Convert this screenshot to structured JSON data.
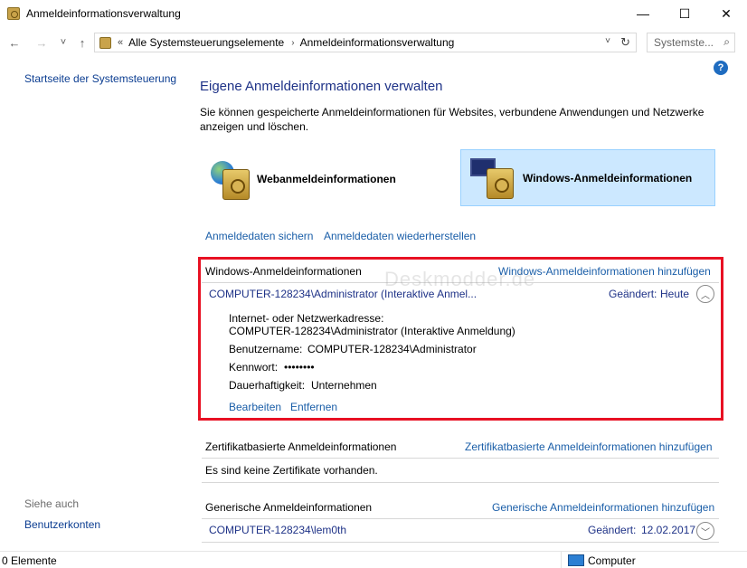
{
  "window": {
    "title": "Anmeldeinformationsverwaltung",
    "controls": {
      "minimize": "—",
      "maximize": "☐",
      "close": "✕"
    }
  },
  "navbar": {
    "back": "←",
    "forward": "→",
    "recent": "˅",
    "up": "↑",
    "breadcrumb_prefix": "«",
    "crumbs": [
      "Alle Systemsteuerungselemente",
      "Anmeldeinformationsverwaltung"
    ],
    "crumb_arrow": "›",
    "dropdown": "˅",
    "refresh": "↻",
    "search_placeholder": "Systemste...",
    "search_icon": "⌕"
  },
  "left_pane": {
    "home_link": "Startseite der Systemsteuerung",
    "see_also_label": "Siehe auch",
    "see_also_link": "Benutzerkonten"
  },
  "help_icon": "?",
  "main": {
    "heading": "Eigene Anmeldeinformationen verwalten",
    "description": "Sie können gespeicherte Anmeldeinformationen für Websites, verbundene Anwendungen und Netzwerke anzeigen und löschen.",
    "categories": [
      {
        "label": "Webanmeldeinformationen",
        "icon": "web-credentials-icon",
        "selected": false
      },
      {
        "label": "Windows-Anmeldeinformationen",
        "icon": "windows-credentials-icon",
        "selected": true
      }
    ],
    "actions": {
      "backup": "Anmeldedaten sichern",
      "restore": "Anmeldedaten wiederherstellen"
    },
    "watermark": "Deskmodder.de",
    "windows_section": {
      "title": "Windows-Anmeldeinformationen",
      "add": "Windows-Anmeldeinformationen hinzufügen",
      "entry": {
        "name": "COMPUTER-128234\\Administrator (Interaktive Anmel...",
        "changed_label": "Geändert:",
        "changed_value": "Heute",
        "chevron": "︿",
        "address_label": "Internet- oder Netzwerkadresse:",
        "address_value": "COMPUTER-128234\\Administrator (Interaktive Anmeldung)",
        "username_label": "Benutzername:",
        "username_value": "COMPUTER-128234\\Administrator",
        "password_label": "Kennwort:",
        "password_value": "••••••••",
        "persistence_label": "Dauerhaftigkeit:",
        "persistence_value": "Unternehmen",
        "edit": "Bearbeiten",
        "remove": "Entfernen"
      }
    },
    "cert_section": {
      "title": "Zertifikatbasierte Anmeldeinformationen",
      "add": "Zertifikatbasierte Anmeldeinformationen hinzufügen",
      "empty": "Es sind keine Zertifikate vorhanden."
    },
    "generic_section": {
      "title": "Generische Anmeldeinformationen",
      "add": "Generische Anmeldeinformationen hinzufügen",
      "entry": {
        "name": "COMPUTER-128234\\lem0th",
        "changed_label": "Geändert:",
        "changed_value": "12.02.2017",
        "chevron": "﹀"
      }
    }
  },
  "statusbar": {
    "items": "0 Elemente",
    "location": "Computer"
  },
  "colors": {
    "link": "#1a5ea8",
    "heading": "#1e3287",
    "highlight": "#e81123",
    "selected_tile": "#cce8ff"
  }
}
